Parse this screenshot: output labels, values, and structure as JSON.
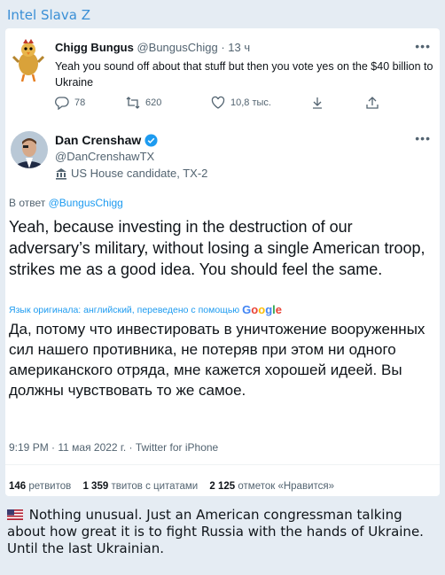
{
  "channel_title": "Intel Slava Z",
  "reply_tweet": {
    "name": "Chigg Bungus",
    "handle": "@BungusChigg",
    "time": " · 13 ч",
    "text": "Yeah you sound off about that stuff but then you vote yes on the $40 billion to Ukraine",
    "replies": "78",
    "retweets": "620",
    "likes": "10,8 тыс."
  },
  "main_tweet": {
    "name": "Dan Crenshaw",
    "handle": "@DanCrenshawTX",
    "label": "US House candidate, TX-2",
    "replying_prefix": "В ответ",
    "replying_to": "@BungusChigg",
    "text": "Yeah, because investing in the destruction of our adversary’s military, without losing a single American troop, strikes me as a good idea. You should feel the same.",
    "translated_note": "Язык оригинала: английский, переведено с помощью",
    "translation": "Да, потому что инвестировать в уничтожение вооруженных сил нашего противника, не потеряв при этом ни одного американского отряда, мне кажется хорошей идеей. Вы должны чувствовать то же самое.",
    "meta": "9:19 PM · 11 мая 2022 г. · Twitter for iPhone",
    "stats": {
      "retweets_count": "146",
      "retweets_label": "ретвитов",
      "quotes_count": "1 359",
      "quotes_label": "твитов с цитатами",
      "likes_count": "2 125",
      "likes_label": "отметок «Нравится»"
    }
  },
  "google_logo": "Google",
  "caption": "Nothing unusual.  Just an American congressman talking about how great it is to fight Russia with the hands of Ukraine. Until the last Ukrainian.",
  "colors": {
    "accent": "#1d9bf0",
    "channel_name": "#3a8fd6",
    "background": "#e5ecf3"
  },
  "icons": [
    "chicken-avatar-icon",
    "reply-icon",
    "retweet-icon",
    "like-icon",
    "share-icon",
    "upload-icon",
    "verified-badge-icon",
    "government-label-icon",
    "more-icon",
    "us-flag-icon"
  ]
}
